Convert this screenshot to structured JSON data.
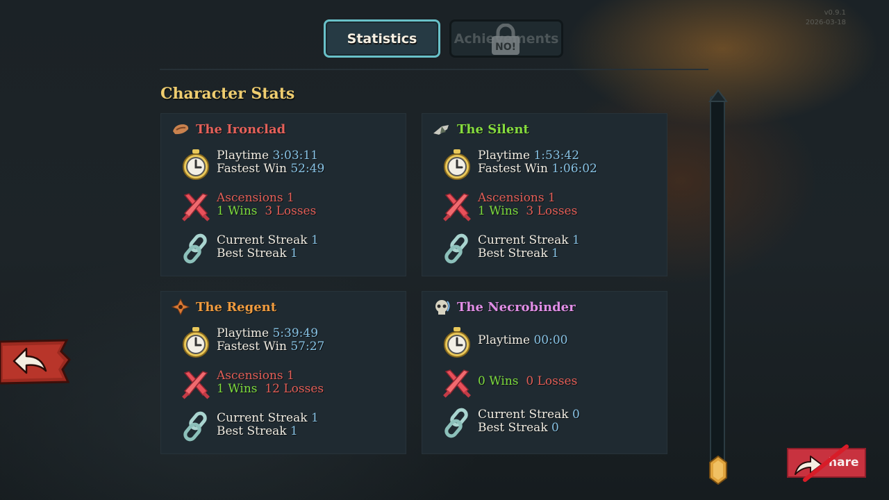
{
  "version": {
    "line1": "v0.9.1",
    "line2": "2026-03-18"
  },
  "tabs": {
    "statistics": "Statistics",
    "achievements": "Achievements",
    "lock_text": "NO!"
  },
  "section_title": "Character Stats",
  "labels": {
    "playtime": "Playtime",
    "fastest_win": "Fastest Win",
    "ascensions": "Ascensions",
    "wins": "Wins",
    "losses": "Losses",
    "current_streak": "Current Streak",
    "best_streak": "Best Streak"
  },
  "characters": [
    {
      "name": "The Ironclad",
      "color": "#e4615a",
      "icon": "ironclad-icon",
      "playtime": "3:03:11",
      "fastest_win": "52:49",
      "ascensions": "1",
      "wins": "1",
      "losses": "3",
      "current_streak": "1",
      "best_streak": "1"
    },
    {
      "name": "The Silent",
      "color": "#86dc3e",
      "icon": "silent-icon",
      "playtime": "1:53:42",
      "fastest_win": "1:06:02",
      "ascensions": "1",
      "wins": "1",
      "losses": "3",
      "current_streak": "1",
      "best_streak": "1"
    },
    {
      "name": "The Regent",
      "color": "#ef9b3f",
      "icon": "regent-icon",
      "playtime": "5:39:49",
      "fastest_win": "57:27",
      "ascensions": "1",
      "wins": "1",
      "losses": "12",
      "current_streak": "1",
      "best_streak": "1"
    },
    {
      "name": "The Necrobinder",
      "color": "#e08ee6",
      "icon": "necrobinder-icon",
      "playtime": "00:00",
      "wins": "0",
      "losses": "0",
      "current_streak": "0",
      "best_streak": "0"
    }
  ],
  "share": {
    "label": "hare"
  },
  "colors": {
    "accent_gold": "#efcd6f",
    "value_blue": "#87c2e4",
    "loss_red": "#e25e57",
    "win_green": "#7edc3e"
  }
}
